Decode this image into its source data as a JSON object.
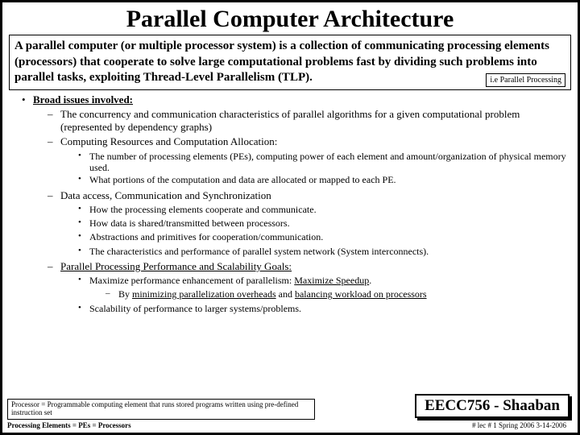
{
  "title": "Parallel Computer Architecture",
  "definition": "A parallel computer (or multiple processor system) is a collection of communicating processing elements (processors) that cooperate to solve large computational problems fast by dividing such problems into parallel tasks, exploiting Thread-Level Parallelism (TLP).",
  "definition_annot": "i.e Parallel Processing",
  "b1": "Broad issues involved:",
  "b2a": "The concurrency and communication characteristics of parallel algorithms for a given computational problem (represented by dependency graphs)",
  "b2b": "Computing Resources and Computation Allocation:",
  "b3a": "The number of processing elements (PEs), computing power of each element and amount/organization of physical memory used.",
  "b3b": "What portions of the computation and  data are allocated or mapped to each PE.",
  "b2c": "Data access, Communication and Synchronization",
  "b3c": "How the processing elements cooperate and communicate.",
  "b3d": "How data is shared/transmitted between processors.",
  "b3e": "Abstractions and primitives for cooperation/communication.",
  "b3f": "The characteristics and performance of parallel system network (System interconnects).",
  "b2d": "Parallel Processing Performance and Scalability Goals:",
  "b3g_pre": "Maximize performance enhancement of parallelism:  ",
  "b3g_u": "Maximize Speedup",
  "b4a_pre": "By ",
  "b4a_u1": "minimizing parallelization overheads",
  "b4a_mid": " and ",
  "b4a_u2": "balancing workload on processors",
  "b3h": "Scalability of performance to larger systems/problems.",
  "fnote_l1": "Processor =  Programmable computing element that runs stored programs written using pre-defined instruction set",
  "fnote_l2": "Processing Elements = PEs = Processors",
  "course": "EECC756 - Shaaban",
  "meta": "#  lec # 1     Spring 2006   3-14-2006"
}
